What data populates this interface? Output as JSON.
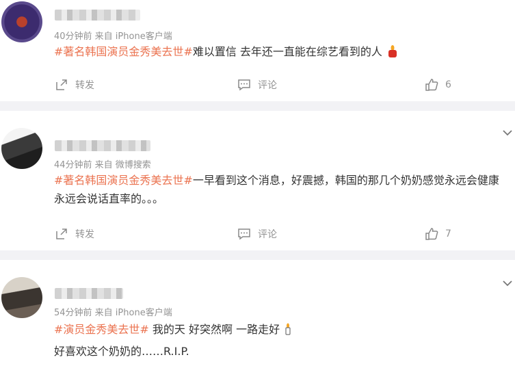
{
  "posts": [
    {
      "meta": "40分钟前  来自 iPhone客户端",
      "hashtag": "#著名韩国演员金秀美去世#",
      "text": "难以置信 去年还一直能在综艺看到的人",
      "emoji_icon": "candle-icon",
      "actions": {
        "repost": "转发",
        "comment": "评论",
        "likes": "6"
      }
    },
    {
      "meta": "44分钟前  来自 微博搜索",
      "hashtag": "#著名韩国演员金秀美去世#",
      "text": "一早看到这个消息，好震撼，韩国的那几个奶奶感觉永远会健康永远会说话直率的。。。",
      "actions": {
        "repost": "转发",
        "comment": "评论",
        "likes": "7"
      }
    },
    {
      "meta": "54分钟前  来自 iPhone客户端",
      "hashtag": "#演员金秀美去世#",
      "text": " 我的天 好突然啊 一路走好",
      "emoji_icon": "candle-icon",
      "line2": "好喜欢这个奶奶的……R.I.P."
    }
  ],
  "colors": {
    "hashtag": "#eb7350",
    "meta": "#939393",
    "separator": "#f2f2f5"
  }
}
